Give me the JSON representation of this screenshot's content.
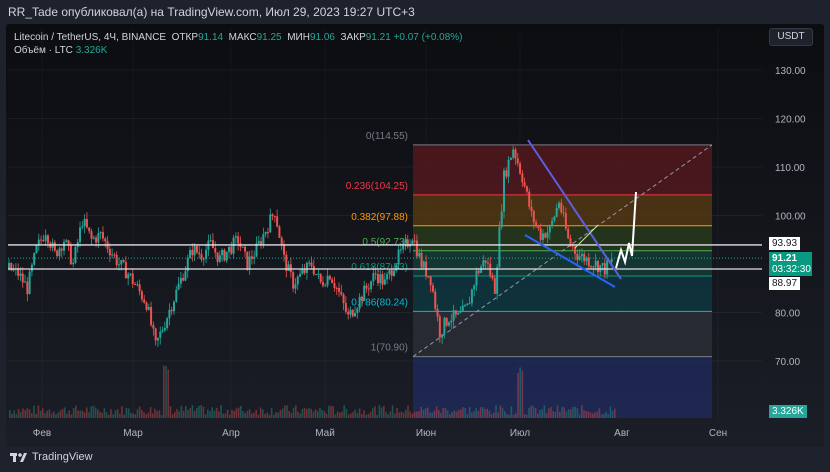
{
  "header": {
    "text": "RR_Tade опубликовал(а) на TradingView.com, Июл 29, 2023 19:27 UTC+3"
  },
  "legend": {
    "symbol": "Litecoin / TetherUS, 4Ч, BINANCE",
    "open_label": "ОТКР",
    "open": "91.14",
    "high_label": "МАКС",
    "high": "91.25",
    "low_label": "МИН",
    "low": "91.06",
    "close_label": "ЗАКР",
    "close": "91.21",
    "change": "+0.07 (+0.08%)",
    "volume_label": "Объём · LTC",
    "volume": "3.326K"
  },
  "currency_button": "USDT",
  "price_axis": {
    "ticks": [
      "130.00",
      "120.00",
      "110.00",
      "100.00",
      "80.00",
      "70.00"
    ]
  },
  "price_tags": {
    "upper_line": "93.93",
    "current_price": "91.21",
    "countdown": "03:32:30",
    "lower_line": "88.97",
    "volume": "3.326K"
  },
  "time_axis": [
    "Фев",
    "Мар",
    "Апр",
    "Май",
    "Июн",
    "Июл",
    "Авг",
    "Сен"
  ],
  "fib_levels": [
    {
      "label": "0(114.55)",
      "price": 114.55,
      "color": "#787b86"
    },
    {
      "label": "0.236(104.25)",
      "price": 104.25,
      "color": "#f23645"
    },
    {
      "label": "0.382(97.88)",
      "price": 97.88,
      "color": "#ff9800"
    },
    {
      "label": "0.5(92.73)",
      "price": 92.73,
      "color": "#4caf50"
    },
    {
      "label": "0.618(87.53)",
      "price": 87.53,
      "color": "#089981"
    },
    {
      "label": "0.786(80.24)",
      "price": 80.24,
      "color": "#00bcd4"
    },
    {
      "label": "1(70.90)",
      "price": 70.9,
      "color": "#787b86"
    }
  ],
  "chart_data": {
    "type": "candlestick",
    "symbol": "LTC/USDT",
    "timeframe": "4H",
    "ylim": [
      65,
      135
    ],
    "approx_closes": [
      89,
      88,
      85,
      93,
      97,
      92,
      95,
      90,
      99,
      95,
      96,
      93,
      90,
      88,
      85,
      82,
      73,
      78,
      83,
      88,
      93,
      92,
      94,
      91,
      93,
      95,
      90,
      93,
      97,
      101,
      91,
      86,
      88,
      90,
      86,
      88,
      84,
      79,
      82,
      85,
      88,
      86,
      90,
      93,
      96,
      90,
      87,
      76,
      79,
      79,
      81,
      88,
      91,
      85,
      108,
      114,
      108,
      100,
      96,
      97,
      103,
      95,
      92,
      91,
      90,
      89,
      91
    ],
    "horizontal_lines": [
      93.93,
      88.97
    ]
  },
  "footer": {
    "brand": "TradingView"
  }
}
